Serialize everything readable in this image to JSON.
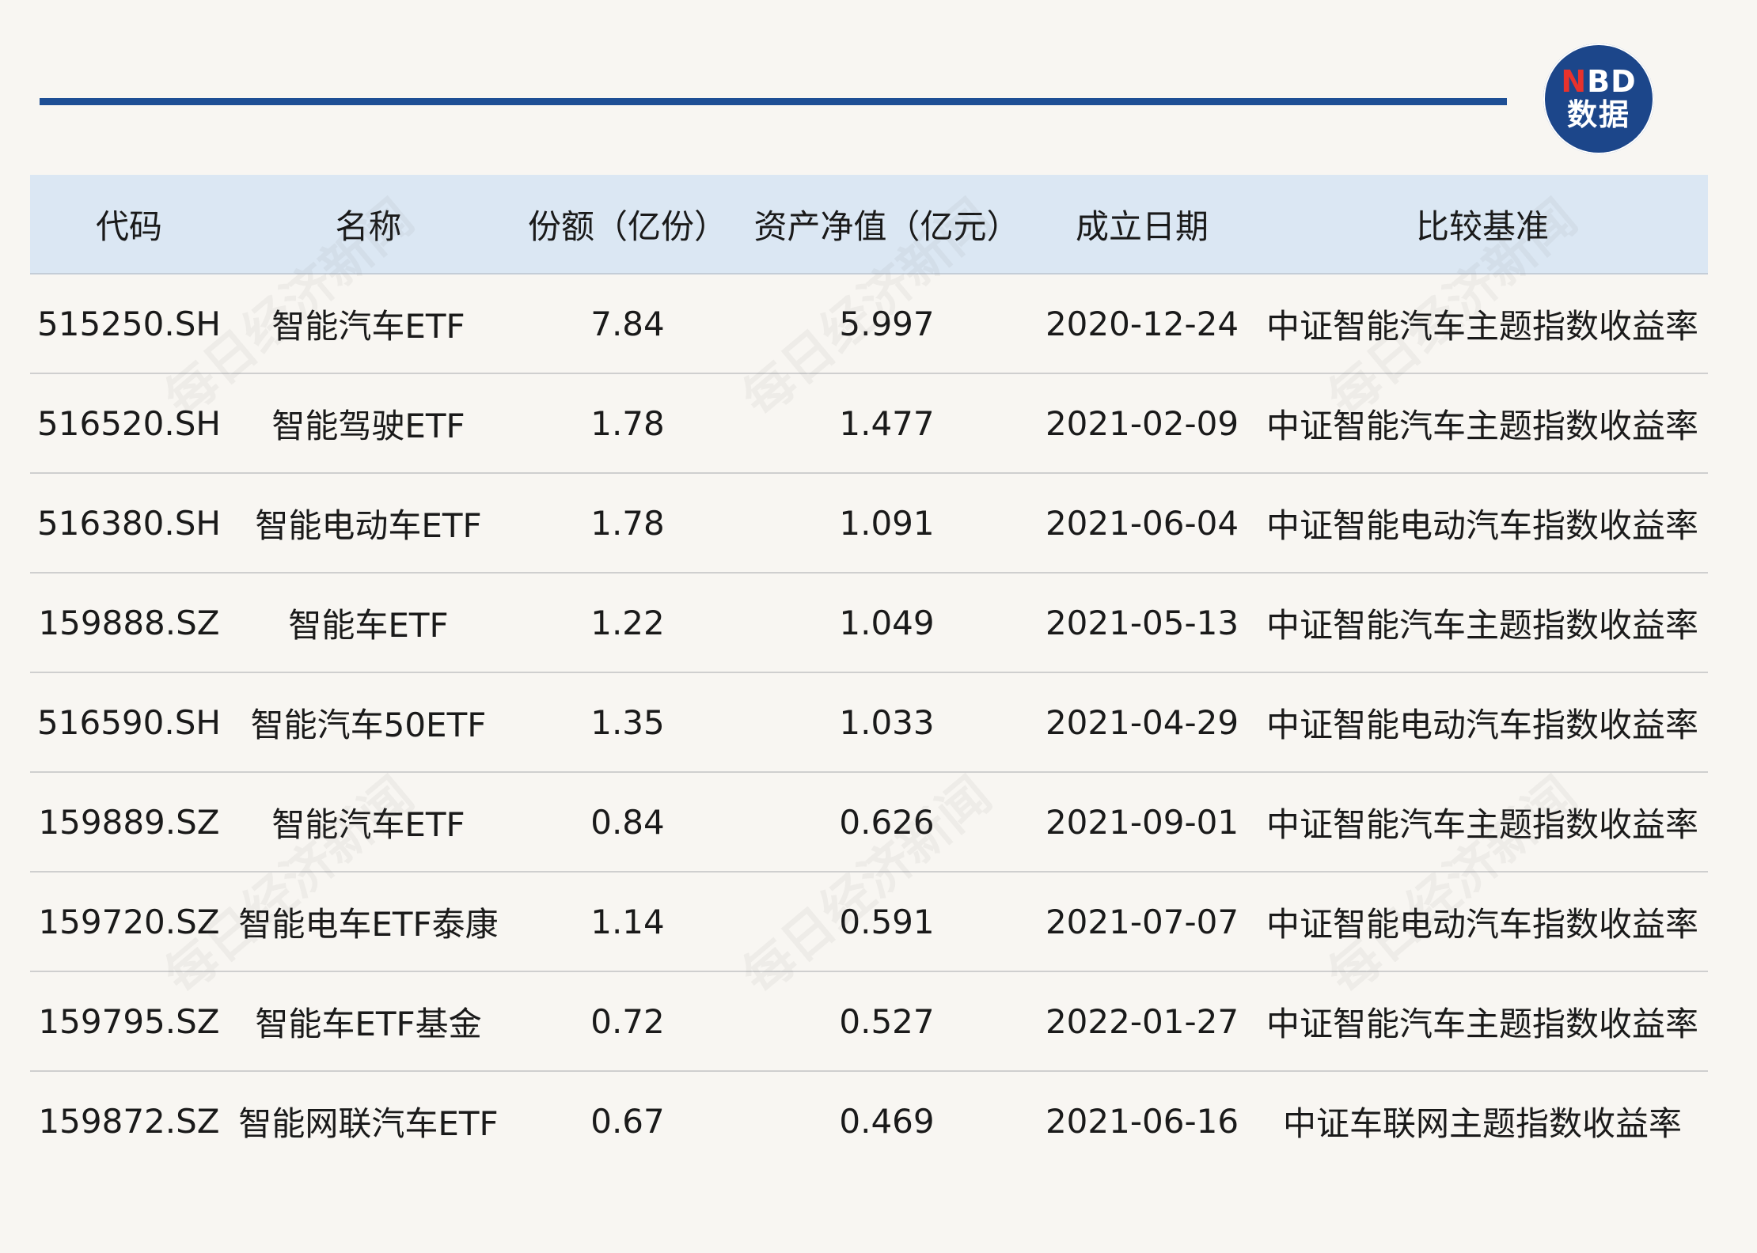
{
  "brand": {
    "logo_line1_accent": "N",
    "logo_line1_rest": "BD",
    "logo_line2": "数据",
    "watermark": "每日经济新闻"
  },
  "colors": {
    "background": "#f8f6f2",
    "rule": "#1e4f95",
    "header_bg": "#dbe7f3",
    "logo_bg": "#1c468a",
    "logo_accent": "#e8322c"
  },
  "table": {
    "columns": [
      "代码",
      "名称",
      "份额（亿份）",
      "资产净值（亿元）",
      "成立日期",
      "比较基准"
    ],
    "rows": [
      [
        "515250.SH",
        "智能汽车ETF",
        "7.84",
        "5.997",
        "2020-12-24",
        "中证智能汽车主题指数收益率"
      ],
      [
        "516520.SH",
        "智能驾驶ETF",
        "1.78",
        "1.477",
        "2021-02-09",
        "中证智能汽车主题指数收益率"
      ],
      [
        "516380.SH",
        "智能电动车ETF",
        "1.78",
        "1.091",
        "2021-06-04",
        "中证智能电动汽车指数收益率"
      ],
      [
        "159888.SZ",
        "智能车ETF",
        "1.22",
        "1.049",
        "2021-05-13",
        "中证智能汽车主题指数收益率"
      ],
      [
        "516590.SH",
        "智能汽车50ETF",
        "1.35",
        "1.033",
        "2021-04-29",
        "中证智能电动汽车指数收益率"
      ],
      [
        "159889.SZ",
        "智能汽车ETF",
        "0.84",
        "0.626",
        "2021-09-01",
        "中证智能汽车主题指数收益率"
      ],
      [
        "159720.SZ",
        "智能电车ETF泰康",
        "1.14",
        "0.591",
        "2021-07-07",
        "中证智能电动汽车指数收益率"
      ],
      [
        "159795.SZ",
        "智能车ETF基金",
        "0.72",
        "0.527",
        "2022-01-27",
        "中证智能汽车主题指数收益率"
      ],
      [
        "159872.SZ",
        "智能网联汽车ETF",
        "0.67",
        "0.469",
        "2021-06-16",
        "中证车联网主题指数收益率"
      ]
    ]
  }
}
